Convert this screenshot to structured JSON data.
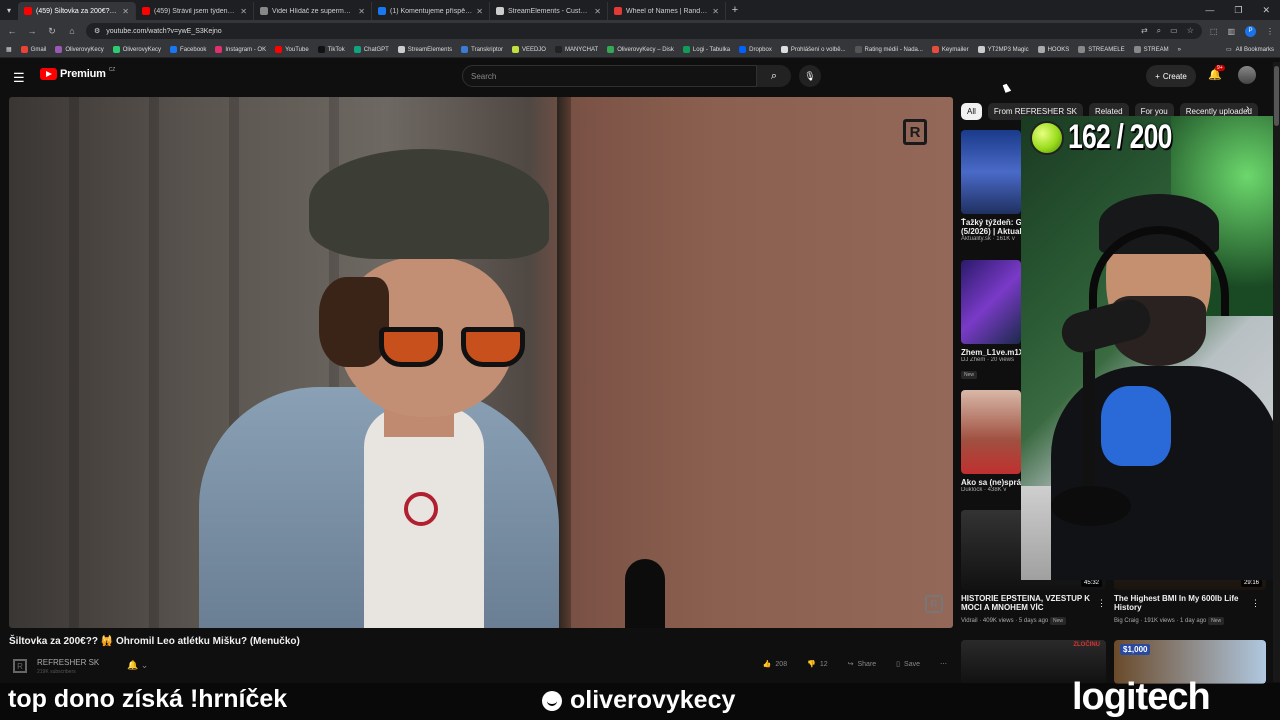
{
  "browser": {
    "tabs": [
      {
        "title": "(459) Šiltovka za 200€?? 🙀",
        "fav": "#ff0000",
        "active": true
      },
      {
        "title": "(459) Strávil jsem týden na Ukr",
        "fav": "#ff0000",
        "active": false
      },
      {
        "title": "Videi Hlídač ze supermarketu",
        "fav": "#888888",
        "active": false
      },
      {
        "title": "(1) Komentujeme příspěvky do",
        "fav": "#1877f2",
        "active": false
      },
      {
        "title": "StreamElements - Custom com",
        "fav": "#cccccc",
        "active": false
      },
      {
        "title": "Wheel of Names | Random nam",
        "fav": "#e53935",
        "active": false
      }
    ],
    "new_tab": "+",
    "address": "youtube.com/watch?v=ywE_S3Kejno",
    "profile_letter": "P",
    "bookmarks": [
      {
        "label": "Gmail",
        "color": "#ea4335"
      },
      {
        "label": "OliverovyKecy",
        "color": "#9b59b6"
      },
      {
        "label": "OliverovyKecy",
        "color": "#2ecc71"
      },
      {
        "label": "Facebook",
        "color": "#1877f2"
      },
      {
        "label": "Instagram - OK",
        "color": "#e1306c"
      },
      {
        "label": "YouTube",
        "color": "#ff0000"
      },
      {
        "label": "TikTok",
        "color": "#111111"
      },
      {
        "label": "ChatGPT",
        "color": "#10a37f"
      },
      {
        "label": "StreamElements",
        "color": "#cccccc"
      },
      {
        "label": "Transkriptor",
        "color": "#3a7bd5"
      },
      {
        "label": "VEEDJO",
        "color": "#c0e040"
      },
      {
        "label": "MANYCHAT",
        "color": "#222222"
      },
      {
        "label": "OliverovyKecy – Disk",
        "color": "#34a853"
      },
      {
        "label": "Logi - Tabulka",
        "color": "#0f9d58"
      },
      {
        "label": "Dropbox",
        "color": "#0061ff"
      },
      {
        "label": "Prohlášení o volbě...",
        "color": "#dddddd"
      },
      {
        "label": "Rating médií - Nada...",
        "color": "#555555"
      },
      {
        "label": "Keymailer",
        "color": "#e74c3c"
      },
      {
        "label": "YT2MP3 Magic",
        "color": "#cccccc"
      },
      {
        "label": "HOOKS",
        "color": "#aaaaaa"
      },
      {
        "label": "STREAMELE",
        "color": "#888888"
      },
      {
        "label": "STREAM",
        "color": "#888888"
      }
    ],
    "all_bookmarks": "All Bookmarks"
  },
  "youtube": {
    "logo_text": "Premium",
    "country": "CZ",
    "search_placeholder": "Search",
    "create_label": "Create",
    "notif_badge": "9+"
  },
  "video": {
    "title": "Šiltovka za 200€?? 🙀 Ohromil Leo atlétku Mišku? (Menučko)",
    "channel": "REFRESHER SK",
    "subscribers": "219K subscribers",
    "likes": "208",
    "dislikes": "12",
    "share_label": "Share",
    "save_label": "Save",
    "watermark": "R"
  },
  "sidebar": {
    "chips": [
      "All",
      "From REFRESHER SK",
      "Related",
      "For you",
      "Recently uploaded"
    ],
    "recs": [
      {
        "title": "Ťažký týždeň: Go",
        "title2": "(5/2026) | Aktuali",
        "meta": "Aktuality.sk · 161K v",
        "new": ""
      },
      {
        "title": "Zhem_L1ve.m1X",
        "title2": "",
        "meta": "DJ Zhem · 20 views",
        "new": "New"
      },
      {
        "title": "Ako sa (ne)správ",
        "title2": "",
        "meta": "Duklock · 438K v",
        "new": ""
      }
    ],
    "wide_recs": [
      {
        "title": "HISTORIE EPSTEINA, VZESTUP K",
        "title2": "MOCI A MNOHEM VÍC",
        "meta": "Vidrail · 409K views · 5 days ago",
        "new": "New",
        "duration": "45:32"
      },
      {
        "title": "The Highest BMI In My 600lb Life",
        "title2": "History",
        "meta": "Big Craig · 191K views · 1 day ago",
        "new": "New",
        "duration": "29:16"
      }
    ],
    "bottom_badge": "$1,000",
    "bottom_badge_right": "ZLOČINU"
  },
  "stream_overlay": {
    "counter": "162 / 200",
    "left_text": "top dono získá !hrníček",
    "mid_text": "oliverovykecy",
    "right_text": "logitech"
  }
}
